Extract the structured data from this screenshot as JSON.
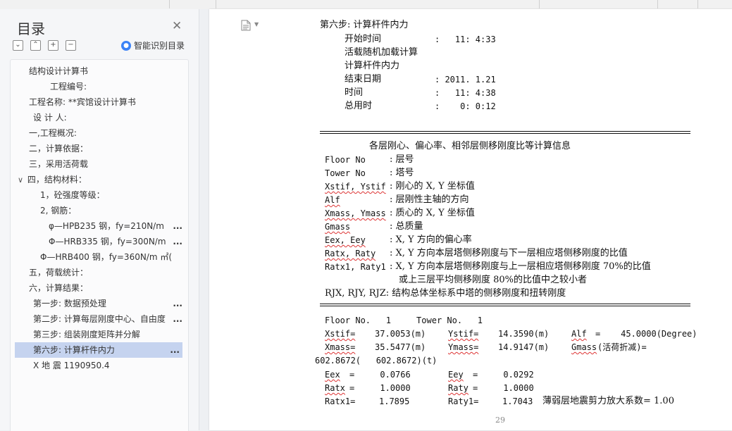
{
  "sidebar": {
    "title": "目录",
    "smart_label": "智能识别目录",
    "items": [
      {
        "label": "结构设计计算书"
      },
      {
        "label": "工程编号:"
      },
      {
        "label": "工程名称: **宾馆设计计算书"
      },
      {
        "label": "设 计 人:"
      },
      {
        "label": "一,工程概况:"
      },
      {
        "label": "二，计算依据："
      },
      {
        "label": "三，采用活荷载"
      },
      {
        "label": "四，结构材料："
      },
      {
        "label": "1，砼强度等级："
      },
      {
        "label": "2,      钢筋："
      },
      {
        "label": "φ—HPB235 钢，fy=210N/m"
      },
      {
        "label": "Φ—HRB335 钢，fy=300N/m"
      },
      {
        "label": "Φ—HRB400 钢，fy=360N/m ㎡("
      },
      {
        "label": "五，荷载统计："
      },
      {
        "label": "六，计算结果："
      },
      {
        "label": "第一步: 数据预处理"
      },
      {
        "label": "第二步: 计算每层刚度中心、自由度"
      },
      {
        "label": "第三步: 组装刚度矩阵并分解"
      },
      {
        "label": "第六步: 计算杆件内力"
      },
      {
        "label": "X 地 震        1190950.4"
      }
    ],
    "dots": "..."
  },
  "doc": {
    "step_title": "第六步: 计算杆件内力",
    "start_label": "开始时间",
    "start_value": ":   11: 4:33",
    "live_load": "活载随机加载计算",
    "calc_force": "计算杆件内力",
    "end_date_label": "结束日期",
    "end_date_value": ": 2011. 1.21",
    "time_label": "时间",
    "time_value": ":   11: 4:38",
    "total_label": "总用时",
    "total_value": ":    0: 0:12",
    "section_title": "各层刚心、偏心率、相邻层侧移刚度比等计算信息",
    "defs": [
      {
        "key": "Floor No",
        "desc": ": 层号"
      },
      {
        "key": "Tower No",
        "desc": ": 塔号"
      },
      {
        "key": "Xstif, Ystif",
        "desc": ": 刚心的 X, Y 坐标值"
      },
      {
        "key": "Alf",
        "desc": ": 层刚性主轴的方向"
      },
      {
        "key": "Xmass, Ymass",
        "desc": ": 质心的 X, Y 坐标值"
      },
      {
        "key": "Gmass",
        "desc": ": 总质量"
      },
      {
        "key": "Eex, Eey",
        "desc": ": X, Y 方向的偏心率"
      },
      {
        "key": "Ratx, Raty",
        "desc": ": X, Y 方向本层塔侧移刚度与下一层相应塔侧移刚度的比值"
      },
      {
        "key": "Ratx1, Raty1",
        "desc": ": X, Y 方向本层塔侧移刚度与上一层相应塔侧移刚度 70%的比值"
      }
    ],
    "defs_cont": "或上三层平均侧移刚度 80%的比值中之较小者",
    "rjx": "RJX, RJY, RJZ: 结构总体坐标系中塔的侧移刚度和扭转刚度",
    "floor_line": "Floor No.   1     Tower No.   1",
    "xstif_k": "Xstif=",
    "xstif_v": "37.0053(m)",
    "ystif_k": "Ystif=",
    "ystif_v": "14.3590(m)",
    "alf_k": "Alf",
    "alf_v": "=    45.0000(Degree)",
    "xmass_k": "Xmass=",
    "xmass_v": "35.5477(m)",
    "ymass_k": "Ymass=",
    "ymass_v": "14.9147(m)",
    "gmass_k": "Gmass",
    "gmass_v": "(活荷折减)=",
    "gmass_line2": "602.8672(   602.8672)(t)",
    "eex_k": "Eex",
    "eex_v": "=     0.0766",
    "eey_k": "Eey",
    "eey_v": "=     0.0292",
    "ratx_k": "Ratx",
    "ratx_v": "=     1.0000",
    "raty_k": "Raty",
    "raty_v": "=     1.0000",
    "ratx1_k": "Ratx1=",
    "ratx1_v": "1.7895",
    "raty1_k": "Raty1=",
    "raty1_v": "1.7043",
    "weak_layer": "薄弱层地震剪力放大系数= 1.00",
    "page_number": "29"
  }
}
